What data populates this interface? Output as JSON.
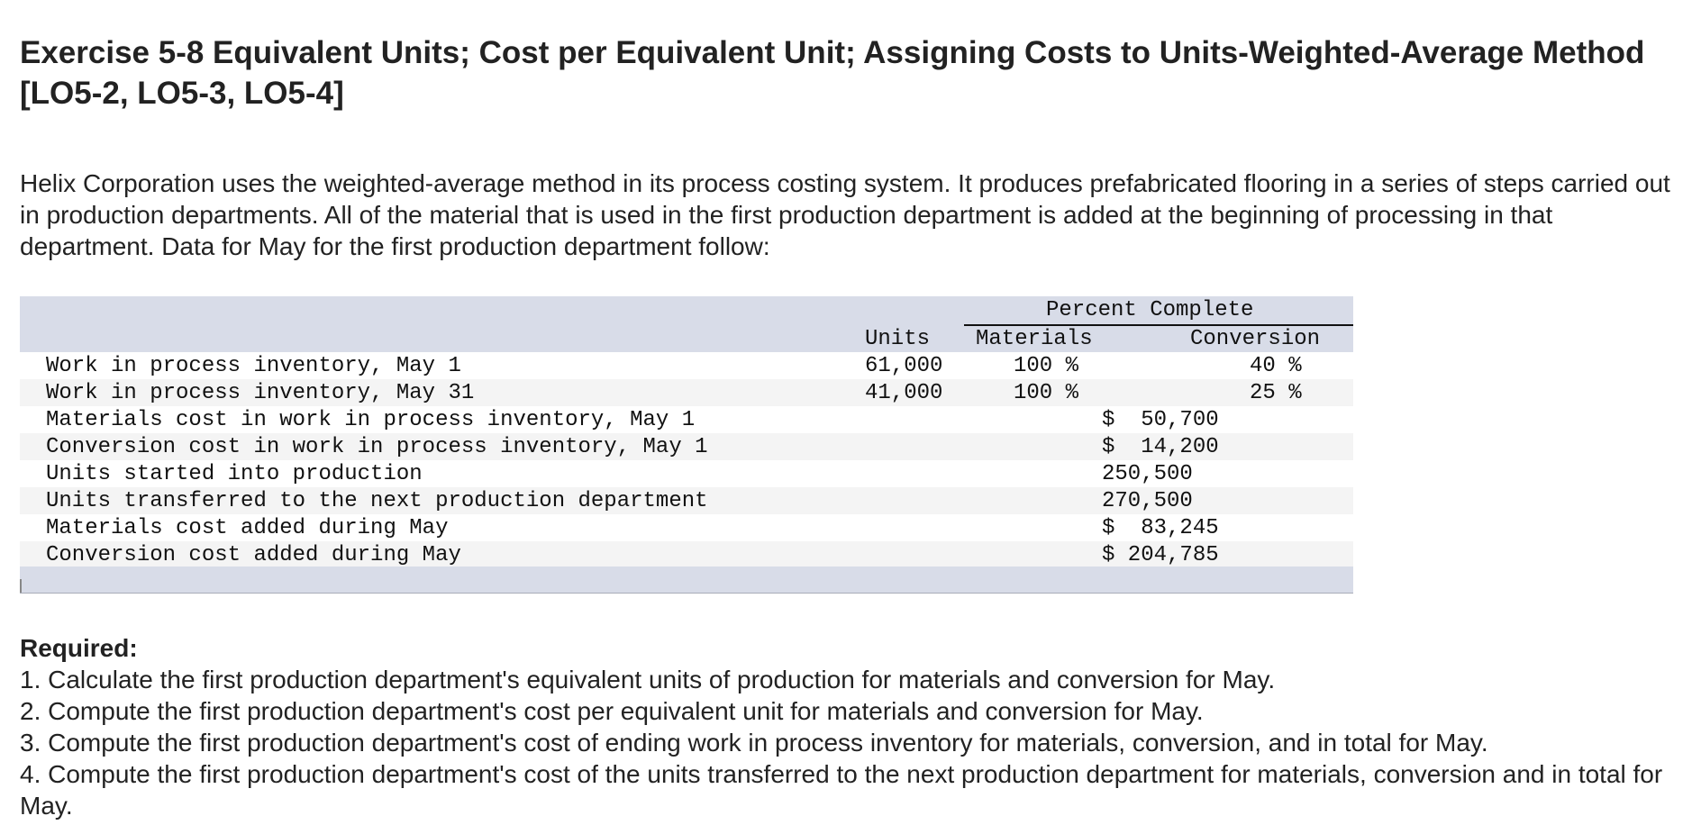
{
  "title": "Exercise 5-8 Equivalent Units; Cost per Equivalent Unit; Assigning Costs to Units-Weighted-Average Method [LO5-2, LO5-3, LO5-4]",
  "intro": "Helix Corporation uses the weighted-average method in its process costing system. It produces prefabricated flooring in a series of steps carried out in production departments. All of the material that is used in the first production department is added at the beginning of processing in that department. Data for May for the first production department follow:",
  "table": {
    "group_header": "Percent Complete",
    "col_units": "Units",
    "col_materials": "Materials",
    "col_conversion": "Conversion",
    "rows": [
      {
        "label": "Work in process inventory, May 1",
        "units": "61,000",
        "materials": "100 %",
        "amount": "",
        "conversion": "40 %"
      },
      {
        "label": "Work in process inventory, May 31",
        "units": "41,000",
        "materials": "100 %",
        "amount": "",
        "conversion": "25 %"
      },
      {
        "label": "Materials cost in work in process inventory, May 1",
        "units": "",
        "materials": "",
        "amount": "$  50,700",
        "conversion": ""
      },
      {
        "label": "Conversion cost in work in process inventory, May 1",
        "units": "",
        "materials": "",
        "amount": "$  14,200",
        "conversion": ""
      },
      {
        "label": "Units started into production",
        "units": "",
        "materials": "",
        "amount": "250,500",
        "conversion": ""
      },
      {
        "label": "Units transferred to the next production department",
        "units": "",
        "materials": "",
        "amount": "270,500",
        "conversion": ""
      },
      {
        "label": "Materials cost added during May",
        "units": "",
        "materials": "",
        "amount": "$  83,245",
        "conversion": ""
      },
      {
        "label": "Conversion cost added during May",
        "units": "",
        "materials": "",
        "amount": "$ 204,785",
        "conversion": ""
      }
    ]
  },
  "required": {
    "heading": "Required:",
    "items": [
      "1. Calculate the first production department's equivalent units of production for materials and conversion for May.",
      "2. Compute the first production department's cost per equivalent unit for materials and conversion for May.",
      "3. Compute the first production department's cost of ending work in process inventory for materials, conversion, and in total for May.",
      "4. Compute the first production department's cost of the units transferred to the next production department for materials, conversion and in total for May."
    ]
  },
  "colors": {
    "table_header_bg": "#d8dce8",
    "row_alt_bg": "#f4f4f4",
    "text": "#222222"
  }
}
